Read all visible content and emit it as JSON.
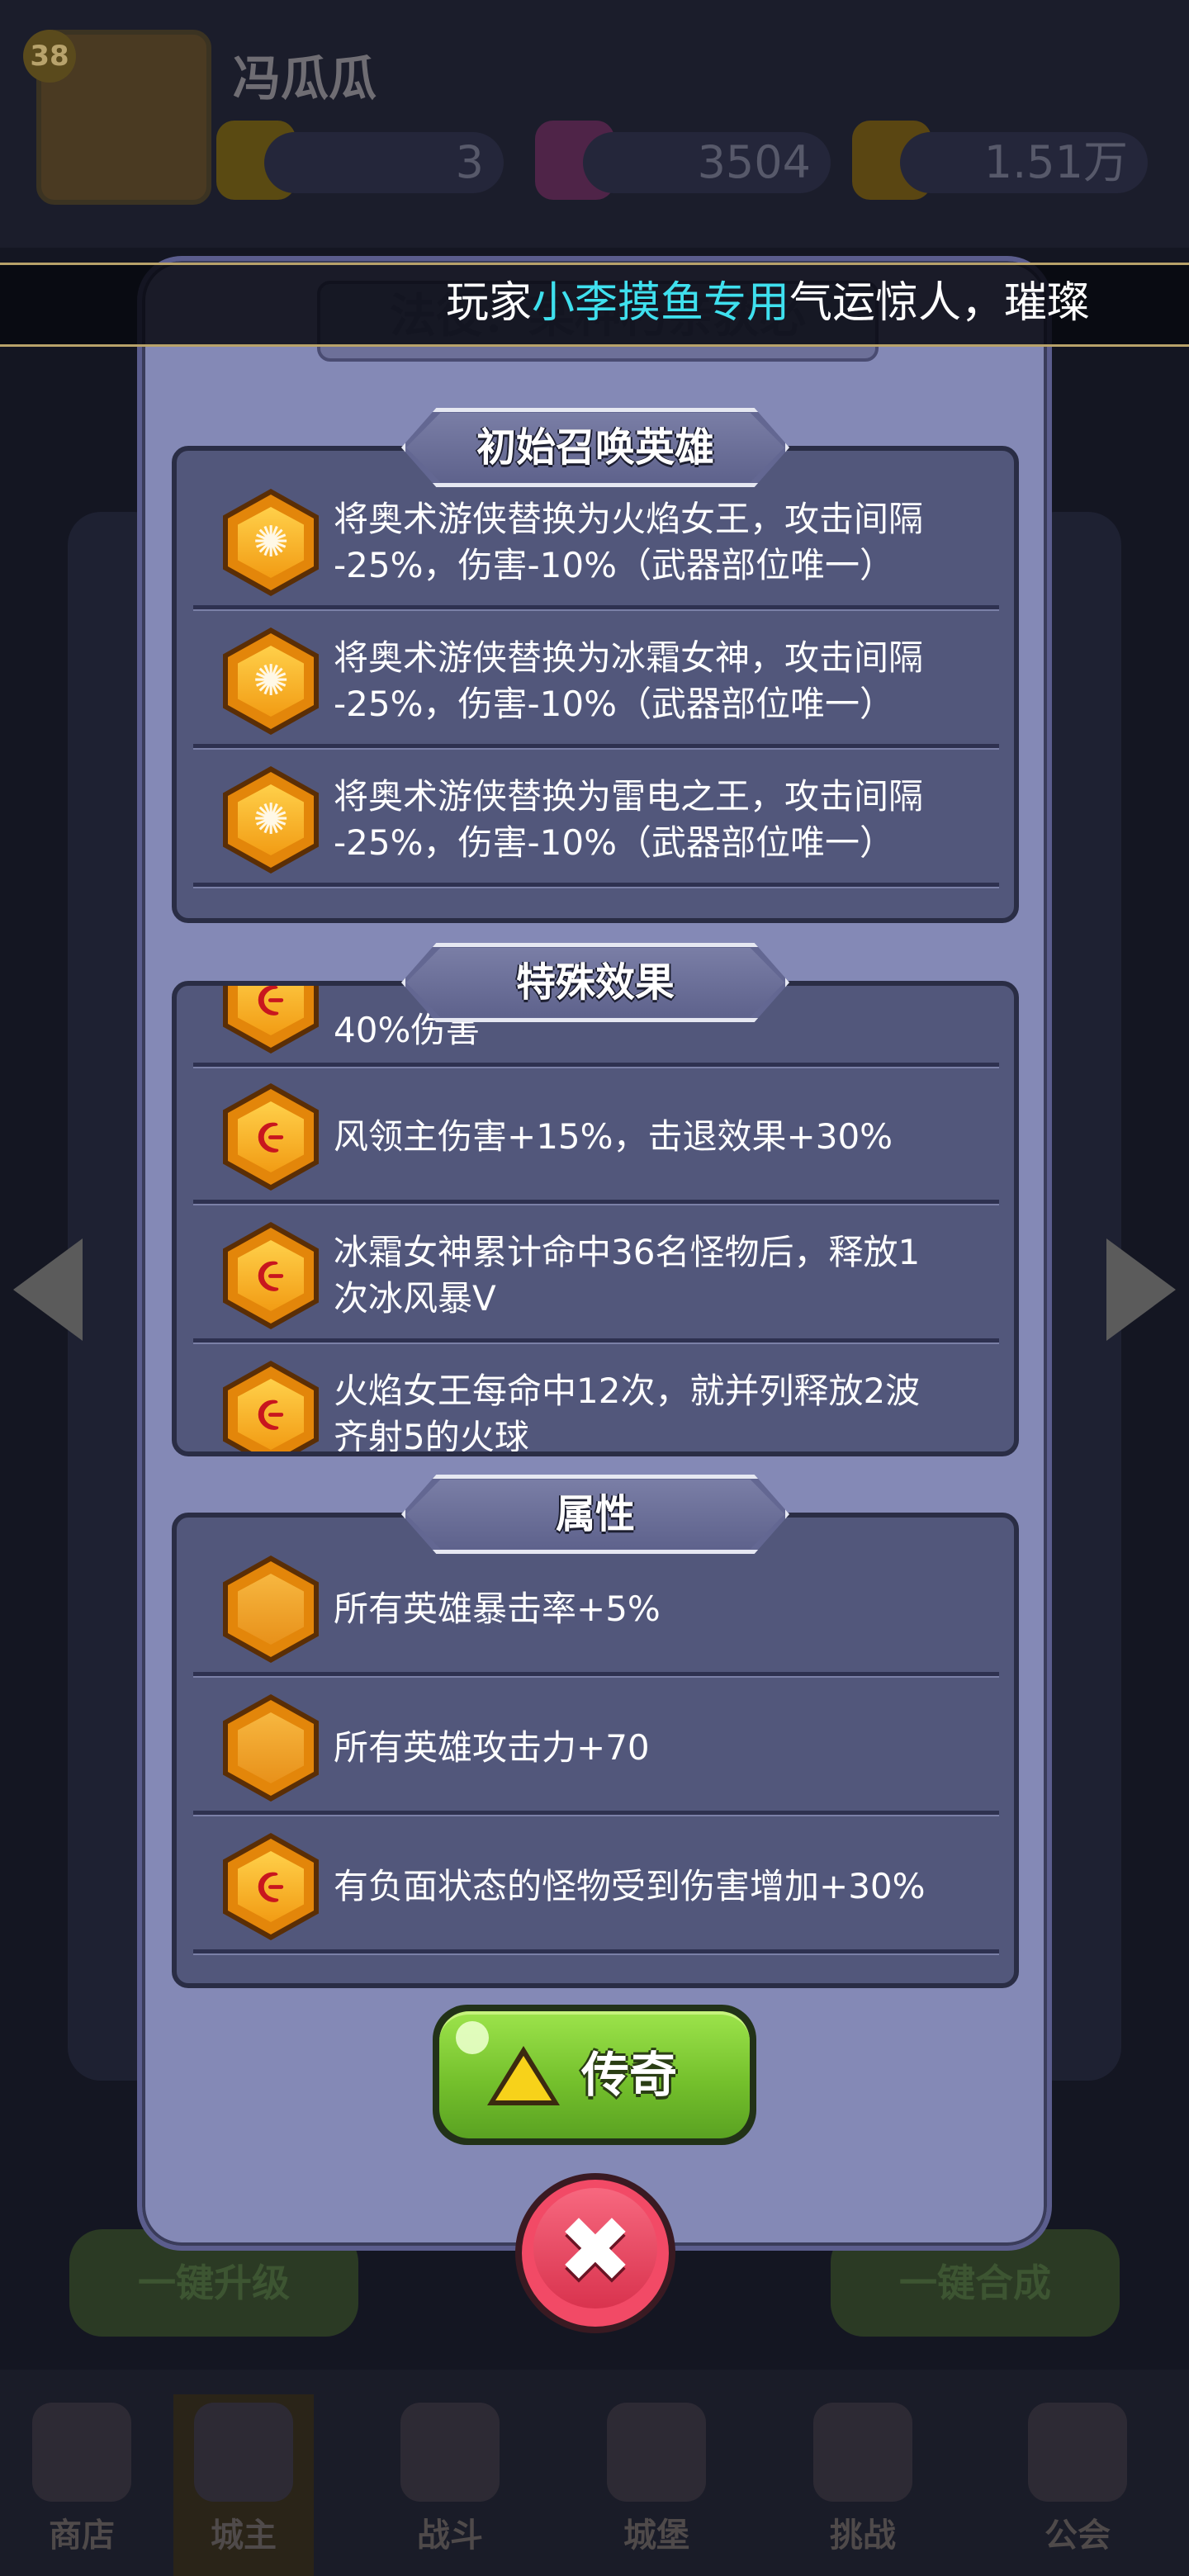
{
  "background": {
    "player": {
      "level": "38",
      "name": "冯瓜瓜"
    },
    "resources": [
      {
        "name": "gems",
        "value": "3"
      },
      {
        "name": "crystals",
        "value": "3504"
      },
      {
        "name": "gold",
        "value": "1.51万"
      }
    ],
    "buttons": {
      "upgrade_all": "一键升级",
      "merge_all": "一键合成"
    },
    "nav": [
      "商店",
      "城主",
      "战斗",
      "城堡",
      "挑战",
      "公会"
    ]
  },
  "banner": {
    "prefix": "玩家",
    "highlight": "小李摸鱼专用",
    "suffix": "气运惊人，璀璨"
  },
  "modal": {
    "ghost_title": "法役：某种朽亲获必",
    "sections": [
      {
        "title": "初始召唤英雄",
        "items": [
          {
            "icon": "star-burst-icon",
            "lines": [
              "将奥术游侠替换为火焰女王，攻击间隔",
              "-25%，伤害-10%（武器部位唯一）"
            ]
          },
          {
            "icon": "star-burst-icon",
            "lines": [
              "将奥术游侠替换为冰霜女神，攻击间隔",
              "-25%，伤害-10%（武器部位唯一）"
            ]
          },
          {
            "icon": "star-burst-icon",
            "lines": [
              "将奥术游侠替换为雷电之王，攻击间隔",
              "-25%，伤害-10%（武器部位唯一）"
            ]
          }
        ]
      },
      {
        "title": "特殊效果",
        "items": [
          {
            "icon": "spiral-icon",
            "lines": [
              "40%伤害"
            ]
          },
          {
            "icon": "spiral-icon",
            "lines": [
              "风领主伤害+15%，击退效果+30%"
            ]
          },
          {
            "icon": "spiral-icon",
            "lines": [
              "冰霜女神累计命中36名怪物后，释放1",
              "次冰风暴V"
            ]
          },
          {
            "icon": "spiral-icon",
            "lines": [
              "火焰女王每命中12次，就并列释放2波",
              "齐射5的火球"
            ]
          }
        ]
      },
      {
        "title": "属性",
        "items": [
          {
            "icon": "plain-hex-icon",
            "lines": [
              "所有英雄暴击率+5%"
            ]
          },
          {
            "icon": "plain-hex-icon",
            "lines": [
              "所有英雄攻击力+70"
            ]
          },
          {
            "icon": "spiral-icon",
            "lines": [
              "有负面状态的怪物受到伤害增加+30%"
            ]
          }
        ]
      }
    ],
    "legend_button": "传奇",
    "close_icon": "close-x-icon"
  }
}
